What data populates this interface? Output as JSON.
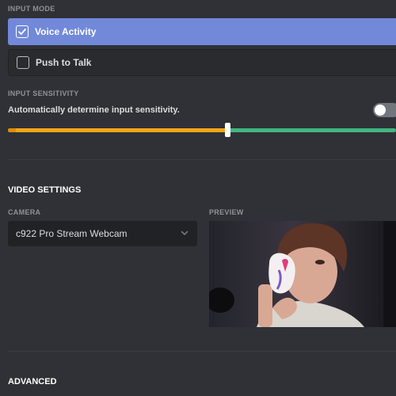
{
  "input_mode": {
    "label": "INPUT MODE",
    "options": [
      {
        "label": "Voice Activity",
        "selected": true
      },
      {
        "label": "Push to Talk",
        "selected": false
      }
    ]
  },
  "input_sensitivity": {
    "label": "INPUT SENSITIVITY",
    "auto_label": "Automatically determine input sensitivity.",
    "auto_enabled": false,
    "level": 0.565
  },
  "video_settings": {
    "heading": "VIDEO SETTINGS",
    "camera_label": "CAMERA",
    "camera_value": "c922 Pro Stream Webcam",
    "preview_label": "PREVIEW"
  },
  "advanced": {
    "heading": "ADVANCED"
  },
  "colors": {
    "accent": "#7289da",
    "slider_low": "#faa61a",
    "slider_high": "#43b581"
  },
  "icons": {
    "checkbox_checked": "check-icon",
    "dropdown": "chevron-down-icon"
  }
}
